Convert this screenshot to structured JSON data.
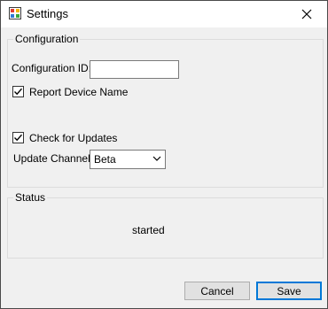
{
  "window": {
    "title": "Settings",
    "app_icon": "settings-app-icon",
    "close_icon": "close-icon"
  },
  "configuration": {
    "legend": "Configuration",
    "config_id_label": "Configuration ID:",
    "config_id_value": "",
    "report_device_name_label": "Report Device Name",
    "report_device_name_checked": true,
    "check_updates_label": "Check for Updates",
    "check_updates_checked": true,
    "update_channel_label": "Update Channel:",
    "update_channel_value": "Beta"
  },
  "status": {
    "legend": "Status",
    "text": "started"
  },
  "buttons": {
    "cancel": "Cancel",
    "save": "Save"
  },
  "colors": {
    "accent": "#0078d7",
    "window_bg": "#f0f0f0"
  }
}
